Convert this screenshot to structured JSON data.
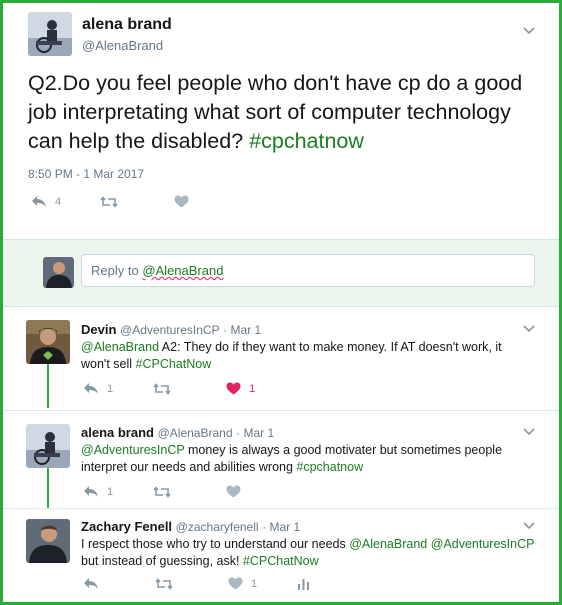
{
  "main_tweet": {
    "name": "alena brand",
    "handle": "@AlenaBrand",
    "text_prefix": "Q2.Do you feel people who don't have cp do a good job interpretating what sort of computer technology can help the disabled? ",
    "hashtag": "#cpchatnow",
    "timestamp": "8:50 PM - 1 Mar 2017",
    "reply_count": "4"
  },
  "reply_box": {
    "prefix": "Reply to ",
    "mention": "@AlenaBrand"
  },
  "replies": [
    {
      "name": "Devin",
      "handle": "@AdventuresInCP",
      "date": "· Mar 1",
      "mention": "@AlenaBrand",
      "text": " A2: They do if they want to make money. If AT doesn't work, it won't sell ",
      "hashtag": "#CPChatNow",
      "reply_count": "1",
      "like_count": "1"
    },
    {
      "name": "alena brand",
      "handle": "@AlenaBrand",
      "date": "· Mar 1",
      "mention": "@AdventuresInCP",
      "text": " money is always a good motivater but sometimes people interpret our needs and abilities wrong ",
      "hashtag": "#cpchatnow",
      "reply_count": "1"
    },
    {
      "name": "Zachary Fenell",
      "handle": "@zacharyfenell",
      "date": "· Mar 1",
      "text_a": "I respect those who try to understand our needs ",
      "mention1": "@AlenaBrand",
      "mention2": "@AdventuresInCP",
      "text_b": " but instead of guessing, ask! ",
      "hashtag": "#CPChatNow",
      "like_count": "1"
    }
  ],
  "colors": {
    "frame": "#2bab3a",
    "link": "#1a7d1f",
    "heart_active": "#e0245e",
    "icon": "#8899a6"
  }
}
